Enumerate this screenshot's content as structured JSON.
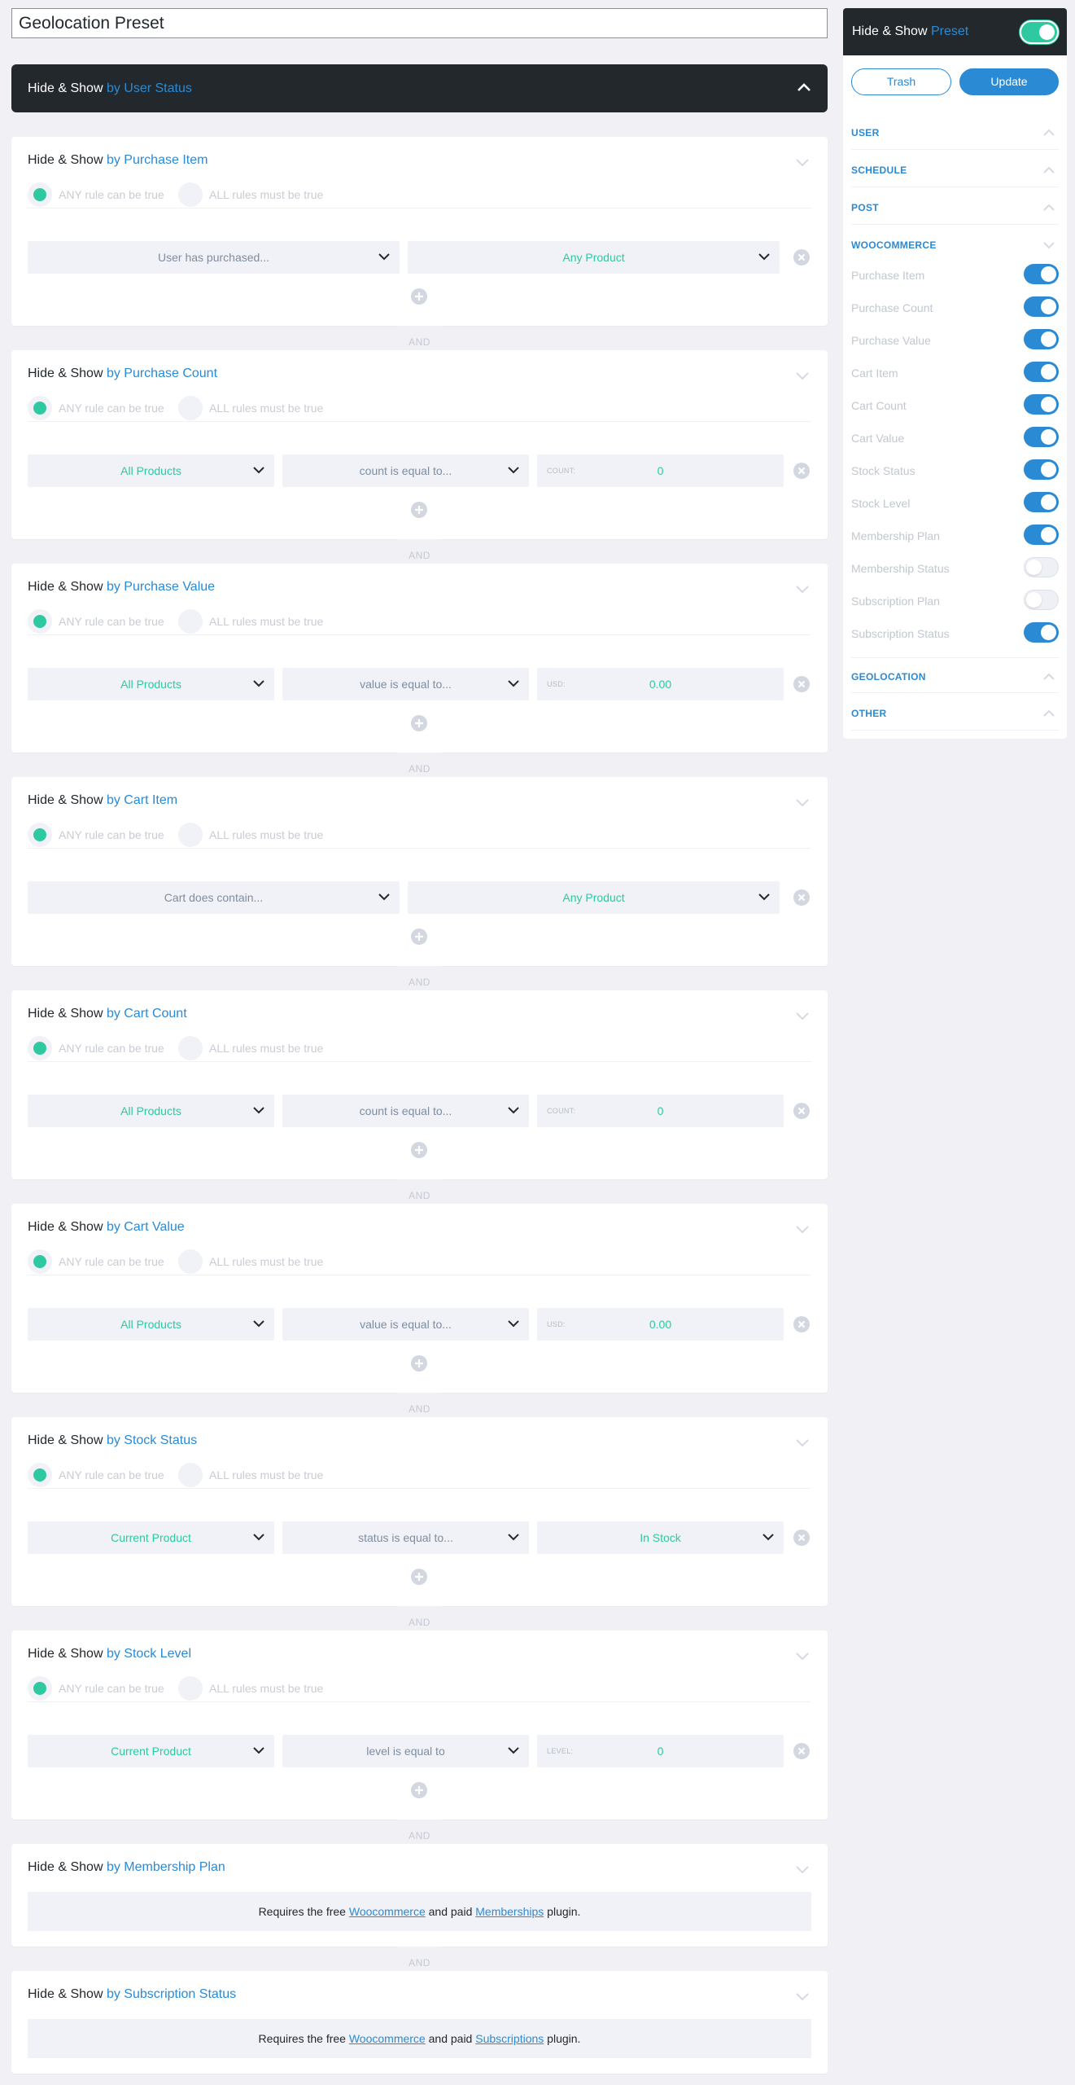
{
  "page": {
    "title_value": "Geolocation Preset"
  },
  "common": {
    "prefix": "Hide & Show ",
    "any_rule": "ANY rule can be true",
    "all_rules": "ALL rules must be true",
    "and": "AND",
    "requires_free": "Requires the free ",
    "woocommerce": "Woocommerce",
    "and_paid": " and paid ",
    "plugin": " plugin."
  },
  "group": {
    "label": "by User Status"
  },
  "cards": {
    "purchase_item": {
      "label": "by Purchase Item",
      "s1": "User has purchased...",
      "s2": "Any Product"
    },
    "purchase_count": {
      "label": "by Purchase Count",
      "s1": "All Products",
      "s2": "count is equal to...",
      "pre": "COUNT:",
      "val": "0"
    },
    "purchase_value": {
      "label": "by Purchase Value",
      "s1": "All Products",
      "s2": "value is equal to...",
      "pre": "USD:",
      "val": "0.00"
    },
    "cart_item": {
      "label": "by Cart Item",
      "s1": "Cart does contain...",
      "s2": "Any Product"
    },
    "cart_count": {
      "label": "by Cart Count",
      "s1": "All Products",
      "s2": "count is equal to...",
      "pre": "COUNT:",
      "val": "0"
    },
    "cart_value": {
      "label": "by Cart Value",
      "s1": "All Products",
      "s2": "value is equal to...",
      "pre": "USD:",
      "val": "0.00"
    },
    "stock_status": {
      "label": "by Stock Status",
      "s1": "Current Product",
      "s2": "status is equal to...",
      "s3": "In Stock"
    },
    "stock_level": {
      "label": "by Stock Level",
      "s1": "Current Product",
      "s2": "level is equal to",
      "pre": "LEVEL:",
      "val": "0"
    },
    "membership_plan": {
      "label": "by Membership Plan",
      "plugin_link": "Memberships"
    },
    "subscription_status": {
      "label": "by Subscription Status",
      "plugin_link": "Subscriptions"
    }
  },
  "sidebar": {
    "title_prefix": "Hide & Show ",
    "title_hl": "Preset",
    "trash": "Trash",
    "update": "Update",
    "sections": {
      "user": "USER",
      "schedule": "SCHEDULE",
      "post": "POST",
      "woocommerce": "WOOCOMMERCE",
      "geolocation": "GEOLOCATION",
      "other": "OTHER"
    },
    "woo_items": [
      {
        "label": "Purchase Item",
        "on": true
      },
      {
        "label": "Purchase Count",
        "on": true
      },
      {
        "label": "Purchase Value",
        "on": true
      },
      {
        "label": "Cart Item",
        "on": true
      },
      {
        "label": "Cart Count",
        "on": true
      },
      {
        "label": "Cart Value",
        "on": true
      },
      {
        "label": "Stock Status",
        "on": true
      },
      {
        "label": "Stock Level",
        "on": true
      },
      {
        "label": "Membership Plan",
        "on": true
      },
      {
        "label": "Membership Status",
        "on": false
      },
      {
        "label": "Subscription Plan",
        "on": false
      },
      {
        "label": "Subscription Status",
        "on": true
      }
    ]
  },
  "icons": {
    "caret": "chevron-down-icon",
    "remove": "close-circle-icon",
    "add": "plus-circle-icon"
  },
  "colors": {
    "accent": "#2a8ad4",
    "green": "#2ec8a1",
    "dark": "#23282d",
    "bg": "#f0f0f5"
  }
}
